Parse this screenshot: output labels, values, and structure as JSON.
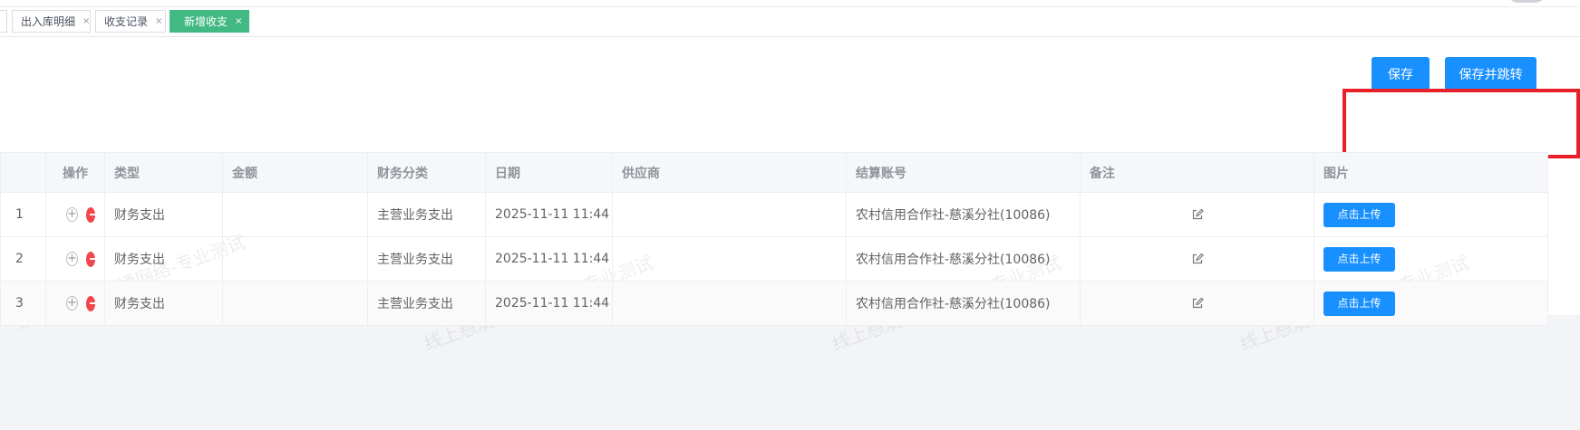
{
  "tabs": [
    {
      "label": "出入库明细",
      "close": "×",
      "active": false
    },
    {
      "label": "收支记录",
      "close": "×",
      "active": false
    },
    {
      "label": "新增收支",
      "close": "×",
      "active": true
    }
  ],
  "actions": {
    "save": "保存",
    "save_jump": "保存并跳转"
  },
  "table": {
    "headers": [
      "",
      "操作",
      "类型",
      "金额",
      "财务分类",
      "日期",
      "供应商",
      "结算账号",
      "备注",
      "图片"
    ],
    "upload_label": "点击上传",
    "rows": [
      {
        "index": "1",
        "type": "财务支出",
        "amount": "",
        "category": "主营业务支出",
        "date": "2025-11-11 11:44",
        "supplier": "",
        "account": "农村信用合作社-慈溪分社(10086)",
        "note": ""
      },
      {
        "index": "2",
        "type": "财务支出",
        "amount": "",
        "category": "主营业务支出",
        "date": "2025-11-11 11:44",
        "supplier": "",
        "account": "农村信用合作社-慈溪分社(10086)",
        "note": ""
      },
      {
        "index": "3",
        "type": "财务支出",
        "amount": "",
        "category": "主营业务支出",
        "date": "2025-11-11 11:44",
        "supplier": "",
        "account": "农村信用合作社-慈溪分社(10086)",
        "note": ""
      }
    ]
  },
  "watermark": "线上慈溪市巅通网络-专业测试",
  "colors": {
    "primary": "#1890ff",
    "tab_active": "#42b983",
    "delete": "#f2454c",
    "highlight": "#e8202a"
  }
}
